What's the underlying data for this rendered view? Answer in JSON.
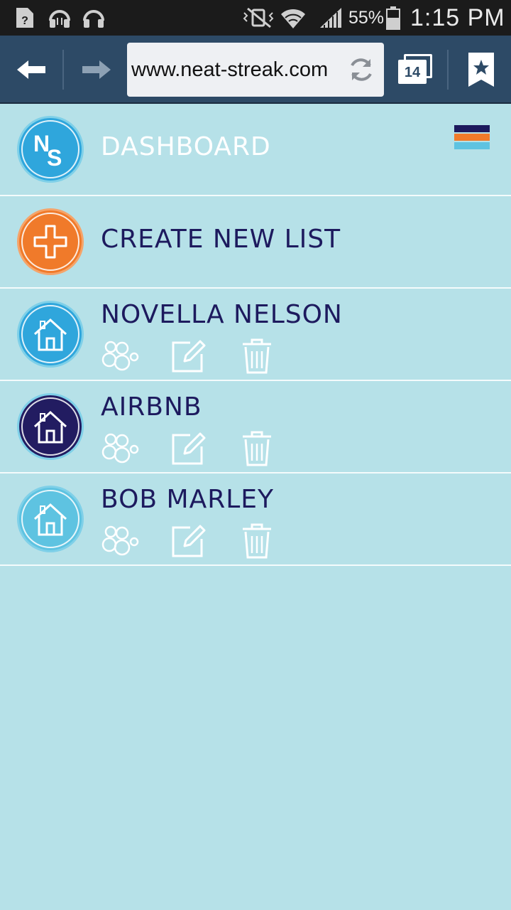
{
  "status_bar": {
    "battery": "55%",
    "time": "1:15 PM",
    "icons": [
      "unknown-file-icon",
      "headphones-icon",
      "headset-icon",
      "vibrate-mute-icon",
      "wifi-icon",
      "signal-icon",
      "battery-icon"
    ]
  },
  "browser": {
    "url": "www.neat-streak.com",
    "tabs_count": "14",
    "icons": [
      "back-arrow-icon",
      "forward-arrow-icon",
      "refresh-icon",
      "tabs-icon",
      "bookmark-icon"
    ]
  },
  "colors": {
    "background": "#b6e1e8",
    "navy": "#1d1a5e",
    "orange": "#f07a2a",
    "blue": "#2fa6dc",
    "light_blue": "#5ec3e1"
  },
  "menu": {
    "dashboard": {
      "label": "DASHBOARD",
      "logo_text": "NS"
    },
    "create": {
      "label": "CREATE NEW LIST"
    }
  },
  "lists": [
    {
      "name": "NOVELLA NELSON",
      "color": "#2fa6dc"
    },
    {
      "name": "AIRBNB",
      "color": "#221c61"
    },
    {
      "name": "BOB MARLEY",
      "color": "#5ec3e1"
    }
  ],
  "list_actions": [
    "bubbles-icon",
    "edit-icon",
    "trash-icon"
  ]
}
